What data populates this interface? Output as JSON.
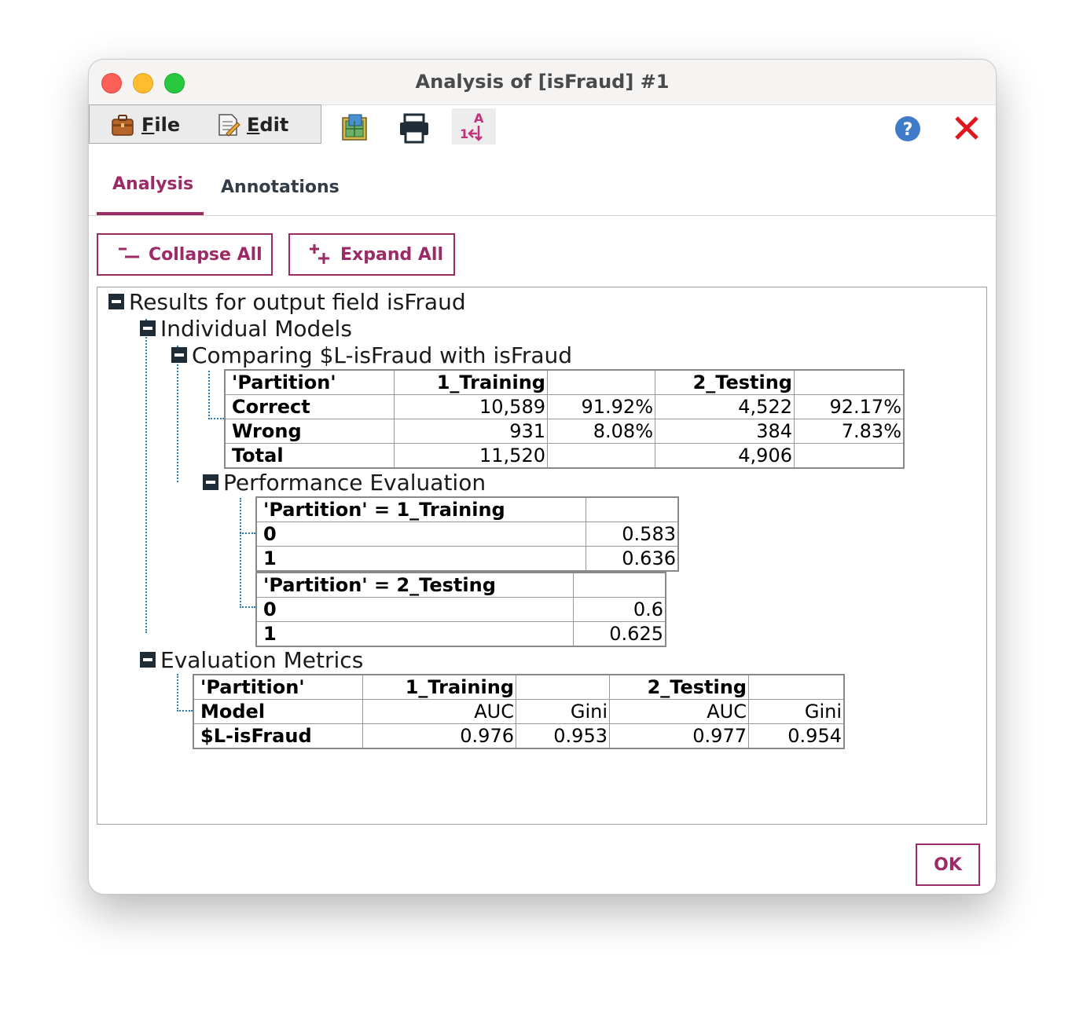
{
  "window": {
    "title": "Analysis of [isFraud] #1"
  },
  "menu": {
    "file": {
      "accel": "F",
      "rest": "ile"
    },
    "edit": {
      "accel": "E",
      "rest": "dit"
    }
  },
  "toolbar": {
    "icons": [
      "export-icon",
      "print-icon",
      "sort-icon",
      "help-icon",
      "close-icon"
    ]
  },
  "tabs": [
    {
      "label": "Analysis"
    },
    {
      "label": "Annotations"
    }
  ],
  "buttons": {
    "collapse_all": "Collapse All",
    "expand_all": "Expand All",
    "ok": "OK"
  },
  "tree": {
    "root": "Results for output field isFraud",
    "individual_models": "Individual Models",
    "comparing": "Comparing $L-isFraud with isFraud",
    "comparing_table": {
      "header": [
        "'Partition'",
        "1_Training",
        "",
        "2_Testing",
        ""
      ],
      "rows": [
        [
          "Correct",
          "10,589",
          "91.92%",
          "4,522",
          "92.17%"
        ],
        [
          "Wrong",
          "931",
          "8.08%",
          "384",
          "7.83%"
        ],
        [
          "Total",
          "11,520",
          "",
          "4,906",
          ""
        ]
      ]
    },
    "performance": "Performance Evaluation",
    "perf_training": {
      "header": [
        "'Partition' = 1_Training",
        ""
      ],
      "rows": [
        [
          "0",
          "0.583"
        ],
        [
          "1",
          "0.636"
        ]
      ]
    },
    "perf_testing": {
      "header": [
        "'Partition' = 2_Testing",
        ""
      ],
      "rows": [
        [
          "0",
          "0.6"
        ],
        [
          "1",
          "0.625"
        ]
      ]
    },
    "evaluation": "Evaluation Metrics",
    "eval_table": {
      "header": [
        "'Partition'",
        "1_Training",
        "",
        "2_Testing",
        ""
      ],
      "rows": [
        [
          "Model",
          "AUC",
          "Gini",
          "AUC",
          "Gini"
        ],
        [
          "$L-isFraud",
          "0.976",
          "0.953",
          "0.977",
          "0.954"
        ]
      ]
    }
  },
  "colors": {
    "accent": "#9b2a66",
    "tree_line": "#2a7ab8"
  }
}
